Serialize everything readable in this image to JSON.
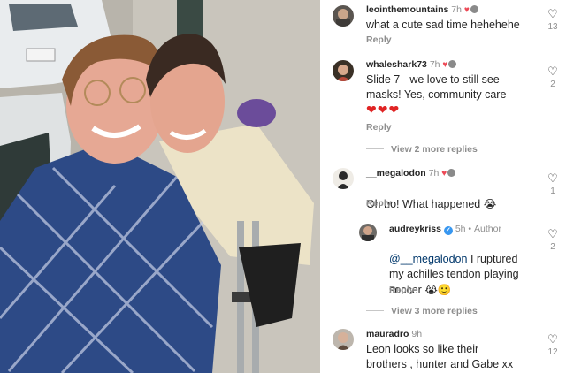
{
  "comments": [
    {
      "username": "leointhemountains",
      "time": "7h",
      "text": "what a cute sad time hehehehe",
      "reply_label": "Reply",
      "likes": "13"
    },
    {
      "username": "whaleshark73",
      "time": "7h",
      "text": "Slide 7 - we love to still see\nmasks! Yes, community care",
      "hearts": "❤❤❤",
      "reply_label": "Reply",
      "likes": "2",
      "view_more": "View 2 more replies"
    },
    {
      "username": "__megalodon",
      "time": "7h",
      "text": "Oh no! What happened",
      "emoji": "😭",
      "reply_label": "Reply",
      "likes": "1"
    },
    {
      "username": "audreykriss",
      "time": "5h",
      "author_label": "Author",
      "mention": "@__megalodon",
      "text": "I ruptured\nmy achilles tendon playing\nsoccer",
      "emoji": "😭🙂",
      "reply_label": "Reply",
      "likes": "2",
      "view_more": "View 3 more replies"
    },
    {
      "username": "mauradro",
      "time": "9h",
      "text": "Leon looks so like their\nbrothers , hunter and Gabe xx",
      "likes": "12"
    }
  ],
  "colors": {
    "heart_red": "#ed4956",
    "verified_blue": "#3897f0",
    "mention_blue": "#00376b",
    "muted": "#8e8e8e"
  }
}
